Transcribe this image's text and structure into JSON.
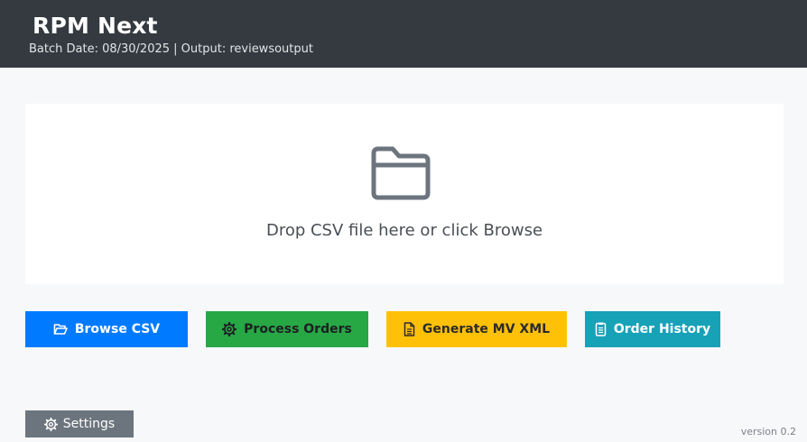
{
  "header": {
    "title": "RPM Next",
    "subtitle": "Batch Date: 08/30/2025 | Output: reviewsoutput"
  },
  "dropzone": {
    "icon": "folder-icon",
    "text": "Drop CSV file here or click Browse"
  },
  "actions": {
    "browse": {
      "label": "Browse CSV",
      "icon": "folder-open-icon",
      "color": "#007bff"
    },
    "process": {
      "label": "Process Orders",
      "icon": "gear-icon",
      "color": "#28a745"
    },
    "generate": {
      "label": "Generate MV XML",
      "icon": "document-icon",
      "color": "#ffc107"
    },
    "history": {
      "label": "Order History",
      "icon": "clipboard-icon",
      "color": "#17a2b8"
    }
  },
  "footer": {
    "settings_label": "Settings",
    "settings_icon": "gear-icon",
    "version": "version 0.2"
  },
  "colors": {
    "header_bg": "#343a40",
    "page_bg": "#f7f8fa",
    "settings_bg": "#6c757d"
  }
}
